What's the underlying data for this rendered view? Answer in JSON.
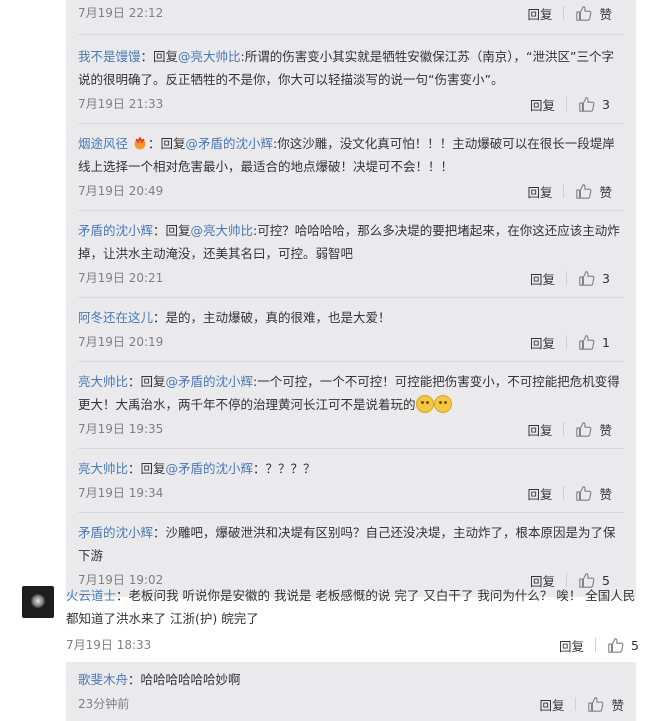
{
  "replies": [
    {
      "time": "7月19日 22:12",
      "reply_label": "回复",
      "like_label": "赞"
    },
    {
      "user": "我不是馒馒",
      "reply_prefix": "：回复",
      "mention": "@亮大帅比",
      "text": ":所谓的伤害变小其实就是牺牲安徽保江苏（南京），“泄洪区”三个字说的很明确了。反正牺牲的不是你，你大可以轻描淡写的说一句“伤害变小”。",
      "time": "7月19日 21:33",
      "reply_label": "回复",
      "like_count": "3"
    },
    {
      "user": "烟途风径",
      "reply_prefix": "：回复",
      "mention": "@矛盾的沈小辉",
      "text": ":你这沙雕，没文化真可怕！！！主动爆破可以在很长一段堤岸线上选择一个相对危害最小，最适合的地点爆破！决堤可不会！！！",
      "time": "7月19日 20:49",
      "reply_label": "回复",
      "like_label": "赞"
    },
    {
      "user": "矛盾的沈小辉",
      "reply_prefix": "：回复",
      "mention": "@亮大帅比",
      "text": ":可控？哈哈哈哈，那么多决堤的要把堵起来，在你这还应该主动炸掉，让洪水主动淹没，还美其名曰，可控。弱智吧",
      "time": "7月19日 20:21",
      "reply_label": "回复",
      "like_count": "3"
    },
    {
      "user": "阿冬还在这儿",
      "text": "：是的，主动爆破，真的很难，也是大爱！",
      "time": "7月19日 20:19",
      "reply_label": "回复",
      "like_count": "1"
    },
    {
      "user": "亮大帅比",
      "reply_prefix": "：回复",
      "mention": "@矛盾的沈小辉",
      "text": ":一个可控，一个不可控！可控能把伤害变小，不可控能把危机变得更大！大禹治水，两千年不停的治理黄河长江可不是说着玩的",
      "time": "7月19日 19:35",
      "reply_label": "回复",
      "like_label": "赞"
    },
    {
      "user": "亮大帅比",
      "reply_prefix": "：回复",
      "mention": "@矛盾的沈小辉",
      "text": "：？？？？",
      "time": "7月19日 19:34",
      "reply_label": "回复",
      "like_label": "赞"
    },
    {
      "user": "矛盾的沈小辉",
      "text": "：沙雕吧，爆破泄洪和决堤有区别吗？自己还没决堤，主动炸了，根本原因是为了保下游",
      "time": "7月19日 19:02",
      "reply_label": "回复",
      "like_count": "5"
    }
  ],
  "main_comment": {
    "user": "火云道士",
    "text": "：老板问我 听说你是安徽的 我说是 老板感慨的说 完了 又白干了 我问为什么？ 唉！ 全国人民都知道了洪水来了 江浙(护) 皖完了",
    "time": "7月19日 18:33",
    "reply_label": "回复",
    "like_count": "5"
  },
  "last_reply": {
    "user": "歌斐木舟",
    "text": "：哈哈哈哈哈哈妙啊",
    "time": "23分钟前",
    "reply_label": "回复",
    "like_label": "赞"
  },
  "colors": {
    "link": "#4a78b5",
    "reply_bg": "#eaeaec",
    "meta": "#808080"
  },
  "icons": {
    "like": "thumbs-up-icon",
    "emoji": "smile-emoji-icon",
    "badge": "user-badge-icon"
  }
}
